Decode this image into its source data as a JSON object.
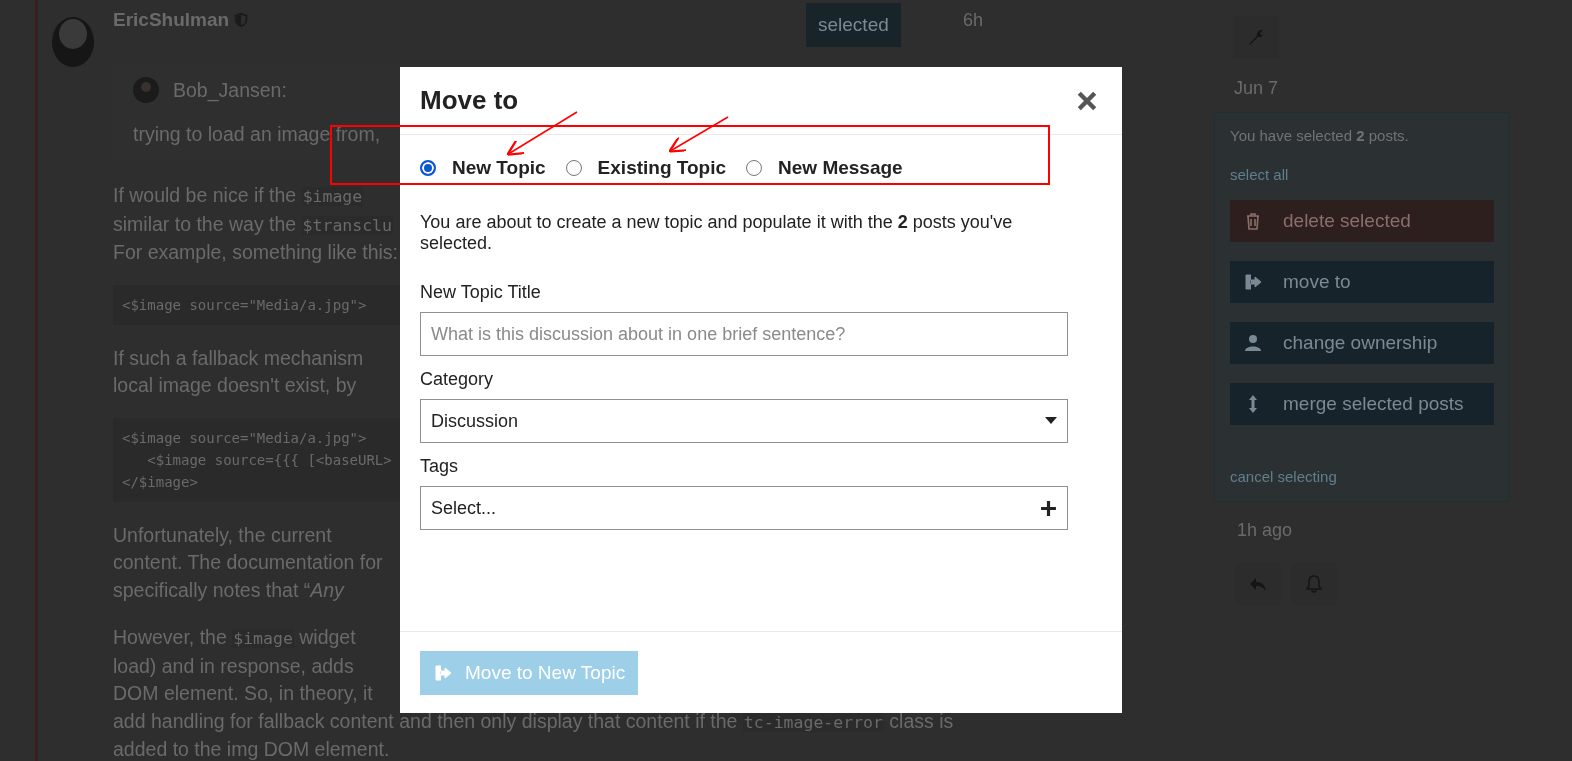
{
  "post": {
    "author": "EricShulman",
    "quote": {
      "author": "Bob_Jansen:",
      "text": "trying to load an image from,"
    },
    "blocks": [
      {
        "kind": "para",
        "lines": [
          [
            {
              "text": "If would be nice if the ",
              "kind": "plain"
            },
            {
              "text": "$image",
              "kind": "code"
            }
          ],
          [
            {
              "text": "similar to the way the ",
              "kind": "plain"
            },
            {
              "text": "$transclu",
              "kind": "code"
            }
          ],
          [
            {
              "text": "For example, something like this:",
              "kind": "plain"
            }
          ]
        ]
      },
      {
        "kind": "code",
        "lines": [
          "<$image source=\"Media/a.jpg\">"
        ]
      },
      {
        "kind": "para",
        "lines": [
          [
            {
              "text": "If such a fallback mechanism",
              "kind": "plain"
            }
          ],
          [
            {
              "text": "local image doesn't exist, by",
              "kind": "plain"
            }
          ]
        ]
      },
      {
        "kind": "code",
        "lines": [
          "<$image source=\"Media/a.jpg\">",
          "   <$image source={{{ [<baseURL>",
          "</$image>"
        ]
      },
      {
        "kind": "para",
        "lines": [
          [
            {
              "text": "Unfortunately, the current",
              "kind": "plain"
            }
          ],
          [
            {
              "text": "content. The documentation for",
              "kind": "plain"
            }
          ],
          [
            {
              "text": "specifically notes that “",
              "kind": "plain"
            },
            {
              "text": "Any",
              "kind": "italic"
            }
          ]
        ]
      },
      {
        "kind": "para",
        "lines": [
          [
            {
              "text": "However, the ",
              "kind": "plain"
            },
            {
              "text": "$image",
              "kind": "code"
            },
            {
              "text": " widget",
              "kind": "plain"
            }
          ],
          [
            {
              "text": "load) and in response, adds",
              "kind": "plain"
            }
          ],
          [
            {
              "text": "DOM element. So, in theory, it",
              "kind": "plain"
            }
          ],
          [
            {
              "text": "add handling for fallback content and then only display that content if the ",
              "kind": "plain"
            },
            {
              "text": "tc-image-error",
              "kind": "code"
            },
            {
              "text": " class is",
              "kind": "plain"
            }
          ],
          [
            {
              "text": "added to the img DOM element.",
              "kind": "plain"
            }
          ]
        ]
      }
    ]
  },
  "post_controls": {
    "select_button": "selected",
    "age": "6h"
  },
  "timeline": {
    "date": "Jun 7",
    "last": "1h ago"
  },
  "selection_panel": {
    "summary": "You have selected **2** posts.",
    "select_all": "select all",
    "actions": [
      {
        "label": "delete selected",
        "kind": "danger"
      },
      {
        "label": "move to",
        "kind": "primary"
      },
      {
        "label": "change ownership",
        "kind": "primary"
      },
      {
        "label": "merge selected posts",
        "kind": "primary"
      }
    ],
    "cancel": "cancel selecting"
  },
  "modal": {
    "title": "Move to",
    "options": [
      {
        "label": "New Topic",
        "selected": true
      },
      {
        "label": "Existing Topic",
        "selected": false
      },
      {
        "label": "New Message",
        "selected": false
      }
    ],
    "description": "You are about to create a new topic and populate it with the **2** posts you've selected.",
    "title_field": {
      "label": "New Topic Title",
      "placeholder": "What is this discussion about in one brief sentence?"
    },
    "category": {
      "label": "Category",
      "value": "Discussion"
    },
    "tags": {
      "label": "Tags",
      "value": "Select..."
    },
    "submit": {
      "label": "Move to New Topic",
      "disabled": true
    }
  }
}
